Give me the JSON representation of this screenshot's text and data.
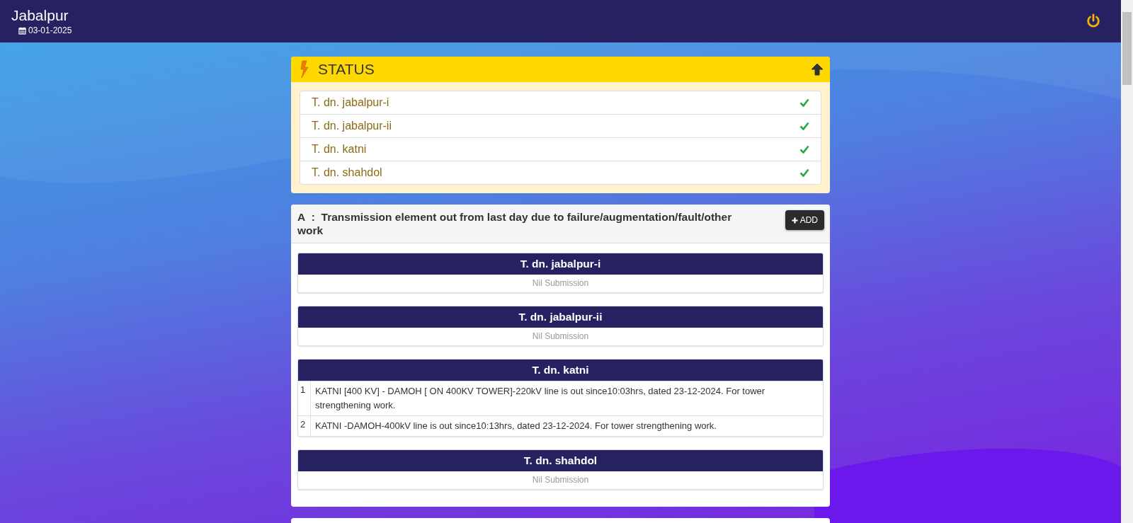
{
  "header": {
    "title": "Jabalpur",
    "date": "03-01-2025"
  },
  "status": {
    "title": "STATUS",
    "items": [
      {
        "name": "T. dn. jabalpur-i",
        "checked": true
      },
      {
        "name": "T. dn. jabalpur-ii",
        "checked": true
      },
      {
        "name": "T. dn. katni",
        "checked": true
      },
      {
        "name": "T. dn. shahdol",
        "checked": true
      }
    ]
  },
  "section": {
    "letter": "A",
    "separator": ":",
    "title": "Transmission element out from last day due to failure/augmentation/fault/other work",
    "add_button": "ADD",
    "groups": [
      {
        "name": "T. dn. jabalpur-i",
        "message": "Nil Submission"
      },
      {
        "name": "T. dn. jabalpur-ii",
        "message": "Nil Submission"
      },
      {
        "name": "T. dn. katni",
        "rows": [
          {
            "number": "1",
            "text": "KATNI [400 KV] - DAMOH [ ON 400KV TOWER]-220kV line is out since10:03hrs, dated 23-12-2024. For tower strengthening work."
          },
          {
            "number": "2",
            "text": "KATNI -DAMOH-400kV line is out since10:13hrs, dated 23-12-2024. For tower strengthening work."
          }
        ]
      },
      {
        "name": "T. dn. shahdol",
        "message": "Nil Submission"
      }
    ]
  }
}
